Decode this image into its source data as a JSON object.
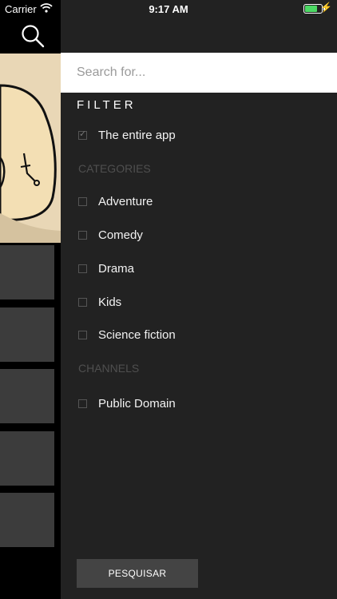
{
  "status_bar": {
    "carrier": "Carrier",
    "time": "9:17 AM",
    "battery_level": 0.85,
    "battery_color": "#4cd964"
  },
  "search": {
    "placeholder": "Search for..."
  },
  "filter": {
    "title": "FILTER",
    "all": {
      "label": "The entire app",
      "checked": true
    },
    "categories_heading": "CATEGORIES",
    "categories": [
      {
        "label": "Adventure",
        "checked": false
      },
      {
        "label": "Comedy",
        "checked": false
      },
      {
        "label": "Drama",
        "checked": false
      },
      {
        "label": "Kids",
        "checked": false
      },
      {
        "label": "Science fiction",
        "checked": false
      }
    ],
    "channels_heading": "CHANNELS",
    "channels": [
      {
        "label": "Public Domain",
        "checked": false
      }
    ]
  },
  "button": {
    "label": "PESQUISAR"
  },
  "icons": {
    "search": "search-icon",
    "wifi": "wifi-icon",
    "battery": "battery-icon",
    "charging": "charging-bolt-icon"
  }
}
